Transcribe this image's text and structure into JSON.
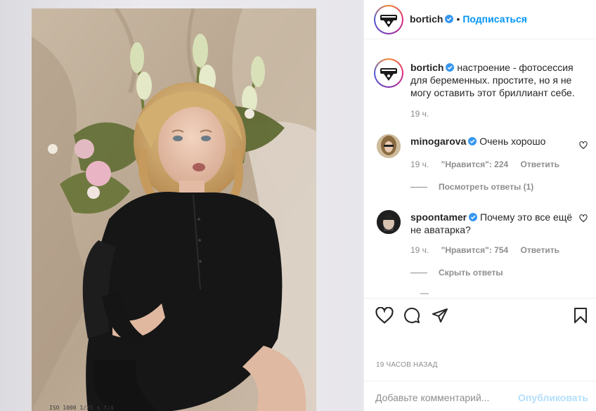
{
  "post": {
    "media_caption_text": "ISO 1000   1/25 s   f/4",
    "author": "bortich",
    "follow_label": "Подписаться",
    "dot": "•"
  },
  "caption": {
    "username": "bortich",
    "text": "настроение - фотосессия для беременных. простите, но я не могу оставить этот бриллиант себе.",
    "time": "19 ч."
  },
  "comments": [
    {
      "username": "minogarova",
      "text": "Очень хорошо",
      "time": "19 ч.",
      "likes": "\"Нравится\": 224",
      "reply": "Ответить",
      "replies_toggle": "Посмотреть ответы (1)"
    },
    {
      "username": "spoontamer",
      "text": "Почему это все ещё не аватарка?",
      "time": "19 ч.",
      "likes": "\"Нравится\": 754",
      "reply": "Ответить",
      "replies_toggle": "Скрыть ответы"
    }
  ],
  "timestamp": "19 ЧАСОВ НАЗАД",
  "add_comment": {
    "placeholder": "Добавьте комментарий...",
    "publish_label": "Опубликовать"
  },
  "icons": {
    "like": "heart-icon",
    "comment": "comment-icon",
    "share": "paper-plane-icon",
    "save": "bookmark-icon",
    "verified": "verified-badge-icon"
  },
  "colors": {
    "link_blue": "#0095f6",
    "verified_blue": "#3897f0",
    "muted": "#8e8e8e",
    "publish_disabled": "#b2dffc"
  }
}
